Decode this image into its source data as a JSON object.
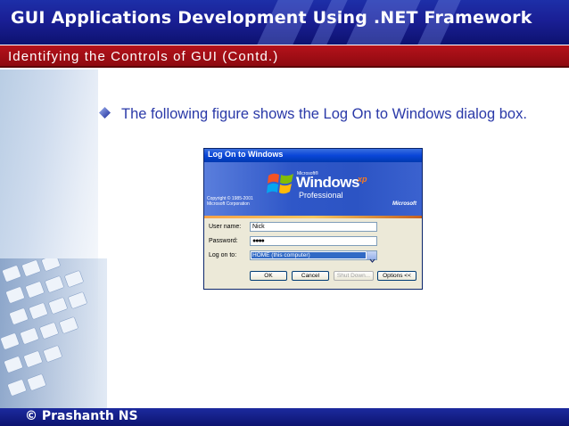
{
  "slide": {
    "title": "GUI Applications Development Using .NET Framework",
    "subtitle": "Identifying the Controls of GUI (Contd.)",
    "bullet": "The following figure shows the Log On to Windows dialog box.",
    "footer": "© Prashanth NS"
  },
  "dialog": {
    "title": "Log On to Windows",
    "banner": {
      "microsoft_small": "Microsoft®",
      "windows": "Windows",
      "xp": "xp",
      "edition": "Professional",
      "copyright_line1": "Copyright © 1985-2001",
      "copyright_line2": "Microsoft Corporation",
      "brand": "Microsoft"
    },
    "fields": {
      "username_label": "User name:",
      "username_value": "Nick",
      "password_label": "Password:",
      "password_value": "●●●●",
      "logon_label": "Log on to:",
      "logon_value": "HOME (this computer)"
    },
    "buttons": {
      "ok": "OK",
      "cancel": "Cancel",
      "shutdown": "Shut Down...",
      "options": "Options <<"
    }
  },
  "colors": {
    "title_bar": "#1a1f95",
    "subtitle_bar": "#b5121b",
    "bullet_text": "#2a39a8",
    "xp_blue": "#0a46d8"
  }
}
